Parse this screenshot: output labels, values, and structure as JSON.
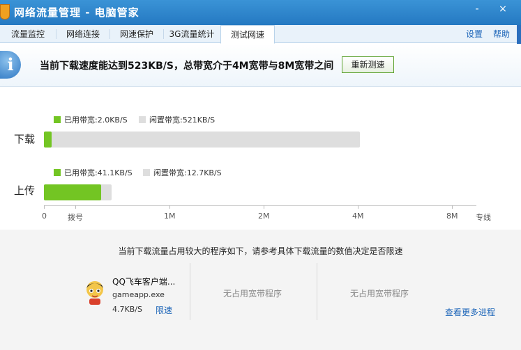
{
  "window": {
    "title": "网络流量管理 - 电脑管家",
    "minimize": "-",
    "close": "×"
  },
  "tabs": [
    {
      "label": "流量监控"
    },
    {
      "label": "网络连接"
    },
    {
      "label": "网速保护"
    },
    {
      "label": "3G流量统计"
    },
    {
      "label": "测试网速",
      "active": true
    }
  ],
  "toplinks": {
    "settings": "设置",
    "help": "帮助"
  },
  "info": {
    "icon": "info-icon",
    "message": "当前下载速度能达到523KB/S，总带宽介于4M宽带与8M宽带之间",
    "retest_label": "重新测速"
  },
  "bandwidth": {
    "download": {
      "label": "下载",
      "used_legend": "已用带宽:2.0KB/S",
      "idle_legend": "闲置带宽:521KB/S",
      "used_kbps": 2.0,
      "total_kbps": 523
    },
    "upload": {
      "label": "上传",
      "used_legend": "已用带宽:41.1KB/S",
      "idle_legend": "闲置带宽:12.7KB/S",
      "used_kbps": 41.1,
      "total_kbps": 53.8
    },
    "axis": [
      "0",
      "拨号",
      "1M",
      "2M",
      "4M",
      "8M",
      "专线"
    ],
    "colors": {
      "used": "#73c523",
      "idle": "#dedede"
    }
  },
  "programs": {
    "heading": "当前下载流量占用较大的程序如下，请参考具体下载流量的数值决定是否限速",
    "items": [
      {
        "name": "QQ飞车客户端...",
        "exe": "gameapp.exe",
        "speed": "4.7KB/S",
        "action": "限速",
        "icon": "qq-speed-game-icon"
      }
    ],
    "empty_slot_1": "无占用宽带程序",
    "empty_slot_2": "无占用宽带程序",
    "more_link": "查看更多进程"
  }
}
